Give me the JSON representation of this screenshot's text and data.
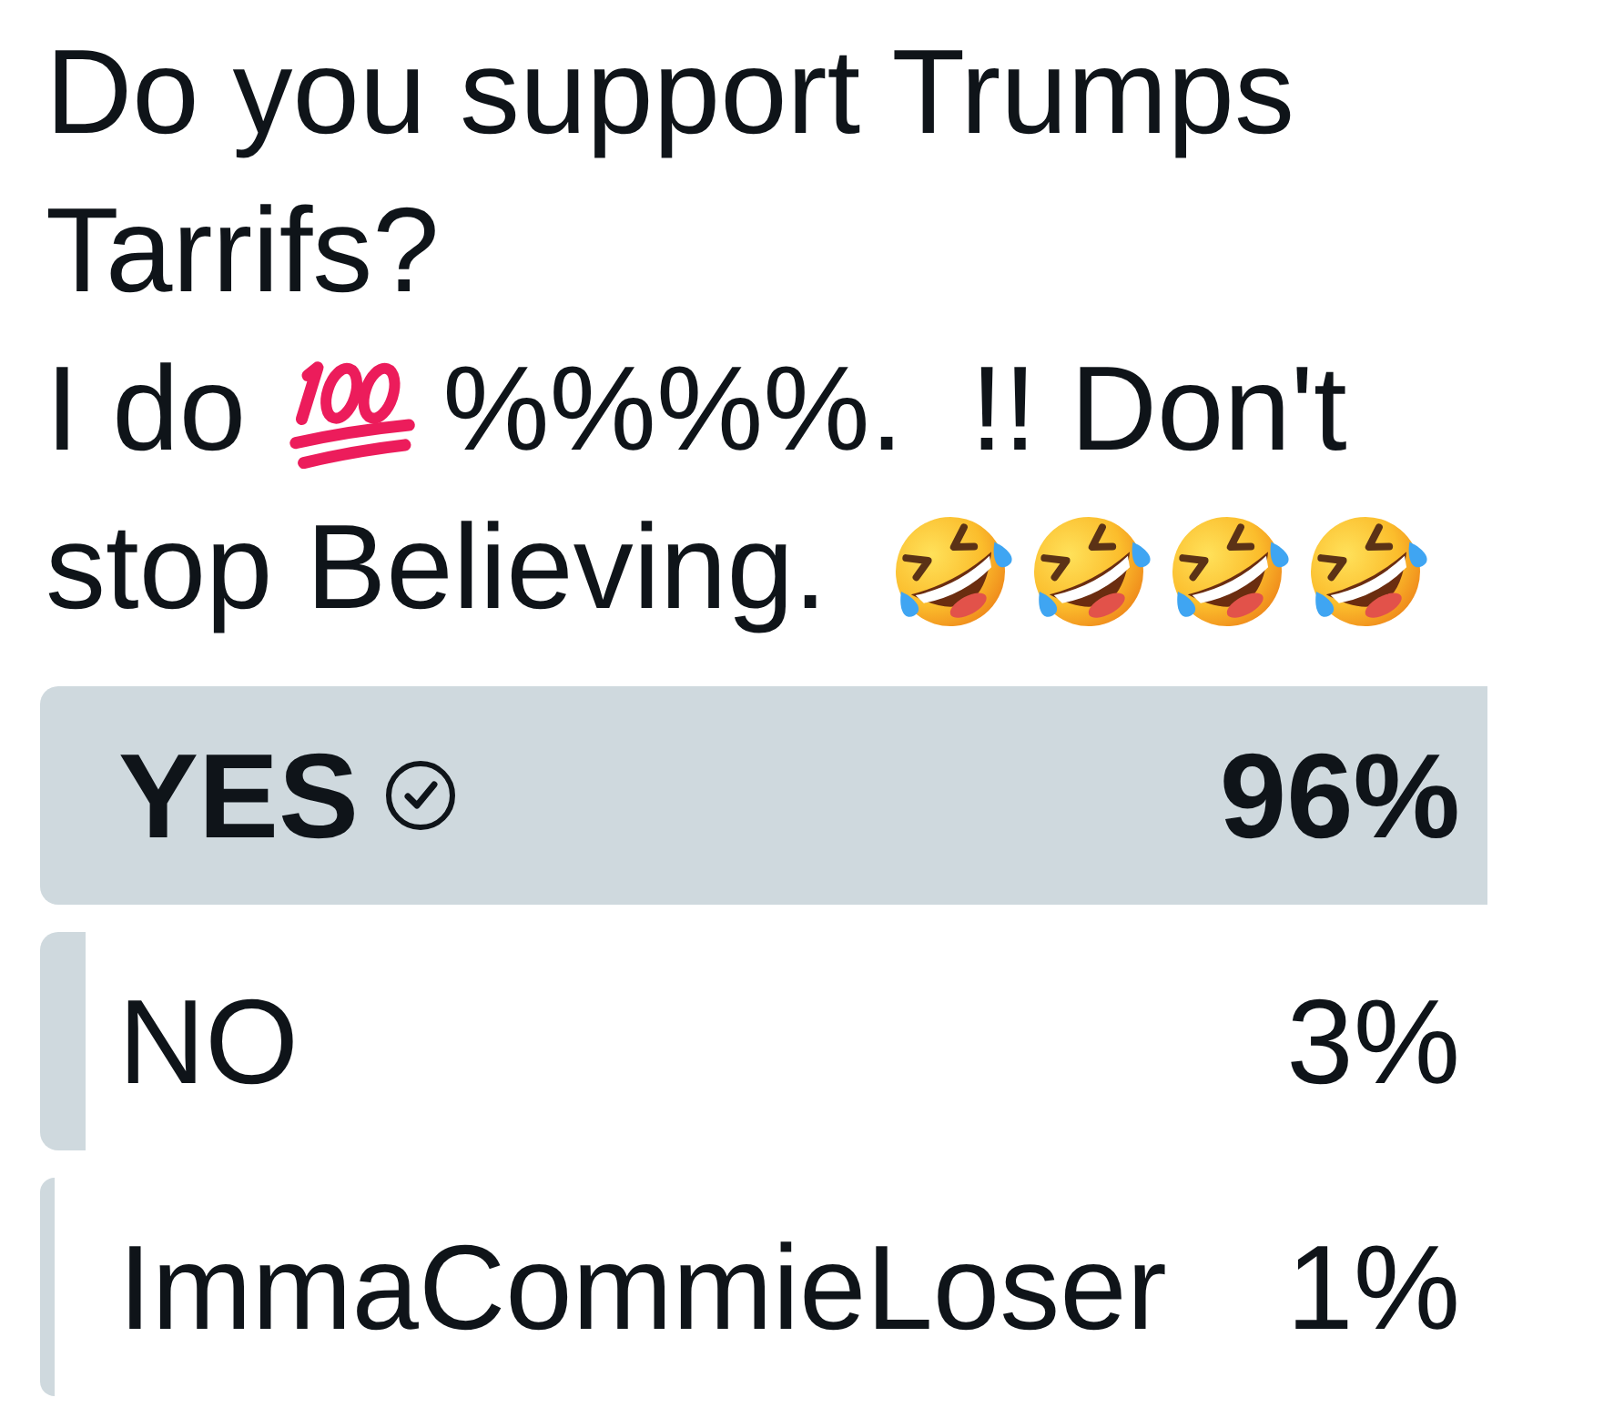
{
  "post": {
    "lines": [
      [
        {
          "kind": "text",
          "text": "Do you support Trumps"
        }
      ],
      [
        {
          "kind": "text",
          "text": "Tarrifs?"
        }
      ],
      [
        {
          "kind": "text",
          "text": "I do"
        },
        {
          "kind": "hundred"
        },
        {
          "kind": "text",
          "text": "%%%%.  !! Don't"
        }
      ],
      [
        {
          "kind": "text",
          "text": "stop Believing."
        },
        {
          "kind": "laughing"
        },
        {
          "kind": "laughing"
        },
        {
          "kind": "laughing"
        },
        {
          "kind": "laughing"
        }
      ]
    ]
  },
  "poll": {
    "options": [
      {
        "label": "YES",
        "percent": "96%",
        "level": 0.96,
        "leading": true,
        "voted": true
      },
      {
        "label": "NO",
        "percent": "3%",
        "level": 0.03,
        "leading": false,
        "voted": false
      },
      {
        "label": "ImmaCommieLoser",
        "percent": "1%",
        "level": 0.01,
        "leading": false,
        "voted": false
      }
    ]
  }
}
